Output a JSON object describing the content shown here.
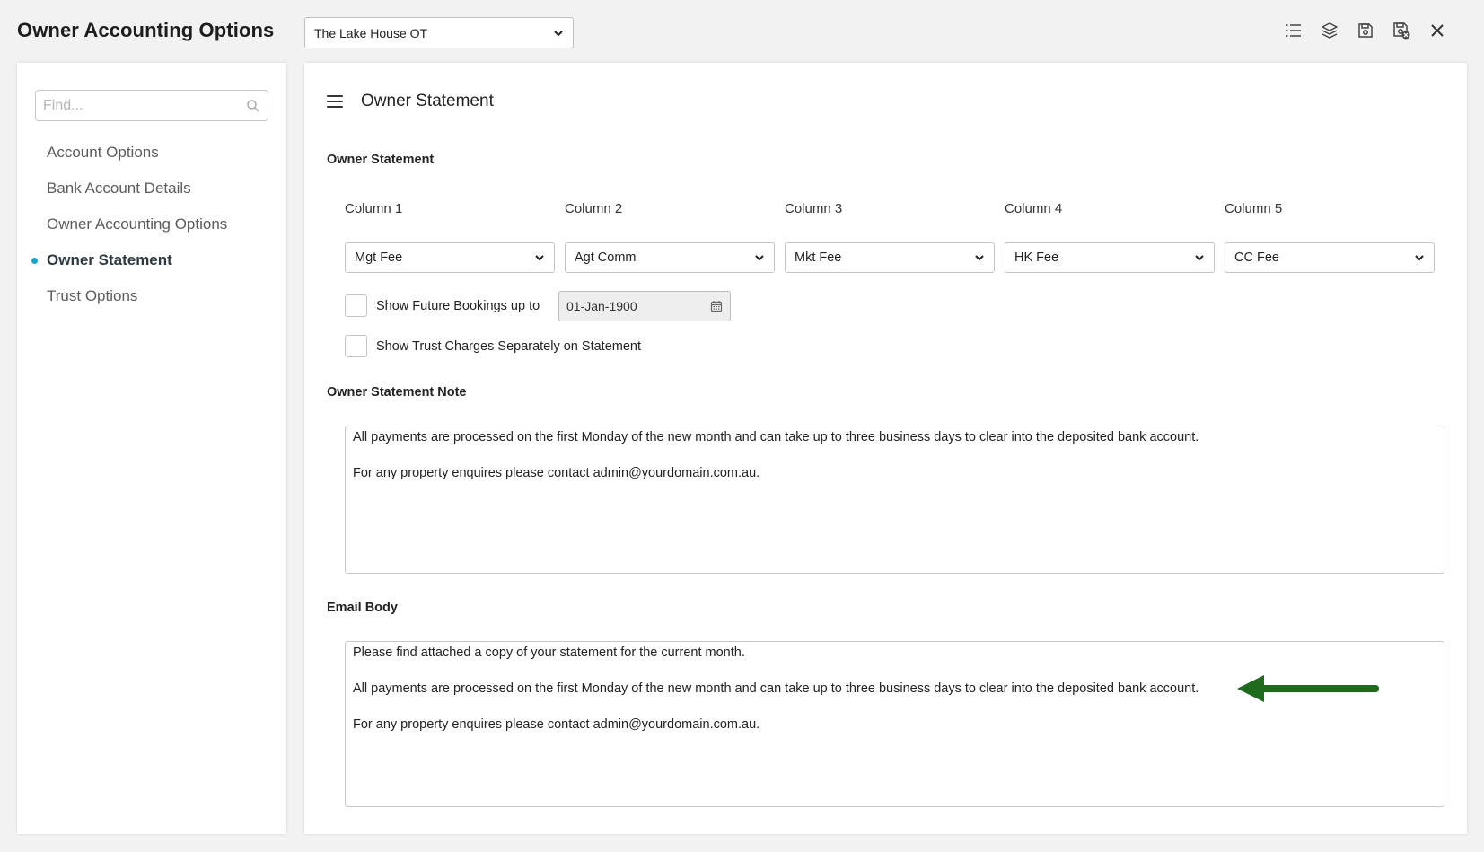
{
  "header": {
    "title": "Owner Accounting Options",
    "property_select": "The Lake House OT",
    "toolbar": [
      "list-icon",
      "layers-icon",
      "save-icon",
      "save-close-icon",
      "close-icon"
    ]
  },
  "sidebar": {
    "search_placeholder": "Find...",
    "items": [
      {
        "label": "Account Options",
        "active": false
      },
      {
        "label": "Bank Account Details",
        "active": false
      },
      {
        "label": "Owner Accounting Options",
        "active": false
      },
      {
        "label": "Owner Statement",
        "active": true
      },
      {
        "label": "Trust Options",
        "active": false
      }
    ],
    "accent_color": "#1aa3c8"
  },
  "main": {
    "title": "Owner Statement",
    "statement": {
      "label": "Owner Statement",
      "columns": [
        {
          "label": "Column 1",
          "value": "Mgt Fee"
        },
        {
          "label": "Column 2",
          "value": "Agt Comm"
        },
        {
          "label": "Column 3",
          "value": "Mkt Fee"
        },
        {
          "label": "Column 4",
          "value": "HK Fee"
        },
        {
          "label": "Column 5",
          "value": "CC Fee"
        }
      ],
      "future_bookings_label": "Show Future Bookings up to",
      "future_bookings_checked": false,
      "future_bookings_date": "01-Jan-1900",
      "trust_charges_label": "Show Trust Charges Separately on Statement",
      "trust_charges_checked": false
    },
    "note": {
      "label": "Owner Statement Note",
      "lines": [
        "All payments are processed on the first Monday of the new month and can take up to three business days to clear into the deposited bank account.",
        "For any property enquires please contact admin@yourdomain.com.au."
      ]
    },
    "email": {
      "label": "Email Body",
      "lines": [
        "Please find attached a copy of your statement for the current month.",
        "All payments are processed on the first Monday of the new month and can take up to three business days to clear into the deposited bank account.",
        "For any property enquires please contact admin@yourdomain.com.au."
      ]
    },
    "annotation_arrow_color": "#1e6b1e"
  }
}
